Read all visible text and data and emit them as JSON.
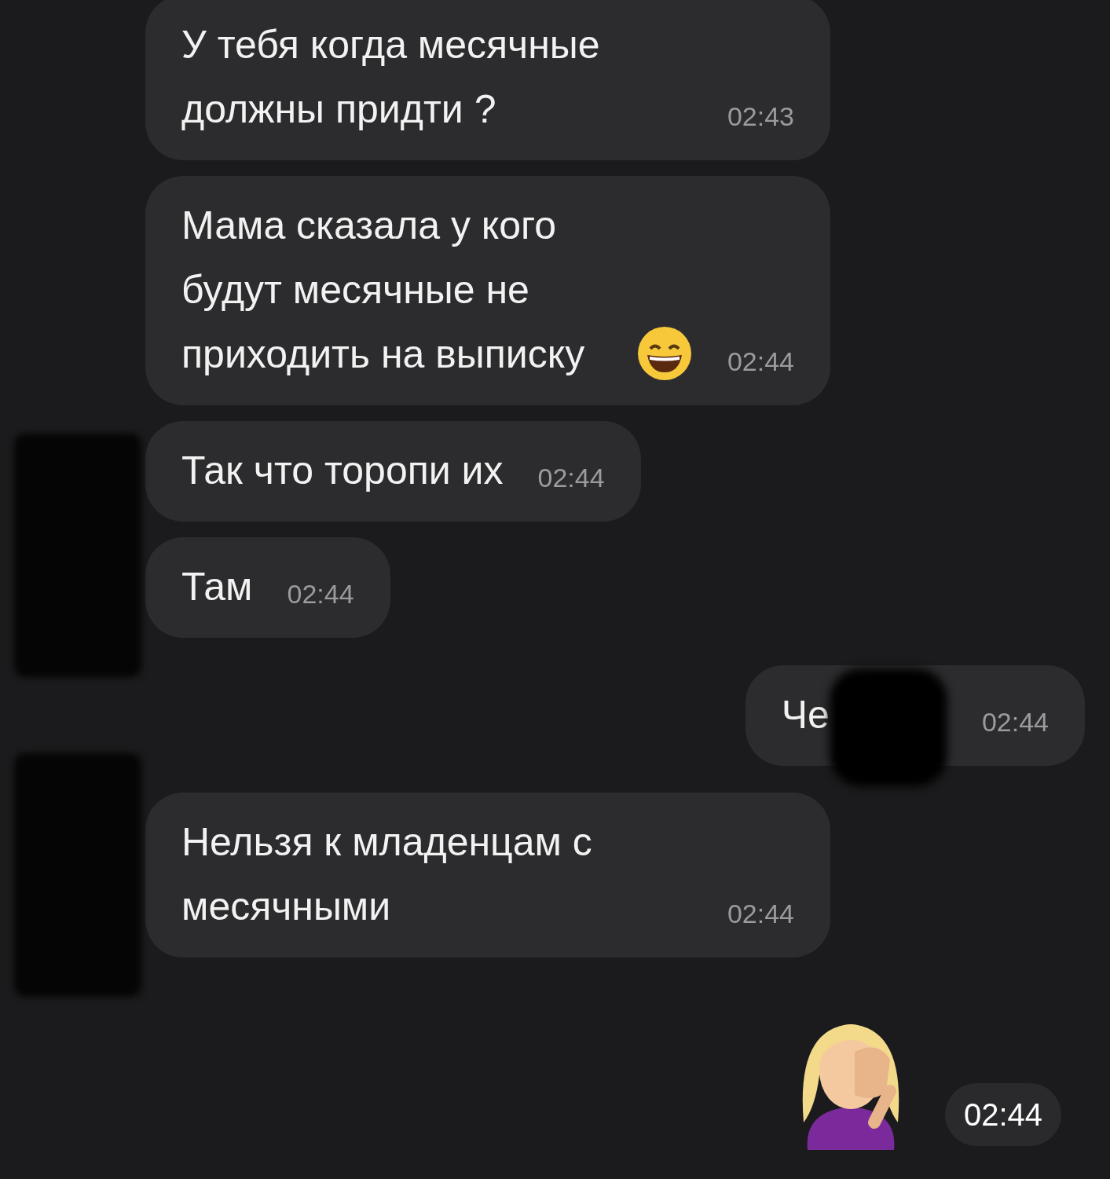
{
  "messages": [
    {
      "kind": "text",
      "outgoing": false,
      "text": "У тебя когда месячные должны придти ?",
      "time": "02:43",
      "emoji": false,
      "redacted": false,
      "avatar_redacted": false
    },
    {
      "kind": "text",
      "outgoing": false,
      "text": "Мама сказала у кого будут месячные не приходить на выписку",
      "time": "02:44",
      "emoji": true,
      "redacted": false,
      "avatar_redacted": false
    },
    {
      "kind": "text",
      "outgoing": false,
      "text": "Так что торопи их",
      "time": "02:44",
      "emoji": false,
      "redacted": false,
      "avatar_redacted": false
    },
    {
      "kind": "text",
      "outgoing": false,
      "text": "Там",
      "time": "02:44",
      "emoji": false,
      "redacted": false,
      "avatar_redacted": true
    },
    {
      "kind": "text",
      "outgoing": true,
      "text": "Че",
      "time": "02:44",
      "emoji": false,
      "redacted": true,
      "avatar_redacted": false
    },
    {
      "kind": "text",
      "outgoing": false,
      "text": "Нельзя к младенцам с месячными",
      "time": "02:44",
      "emoji": false,
      "redacted": false,
      "avatar_redacted": true
    },
    {
      "kind": "sticker",
      "outgoing": true,
      "time": "02:44"
    }
  ]
}
